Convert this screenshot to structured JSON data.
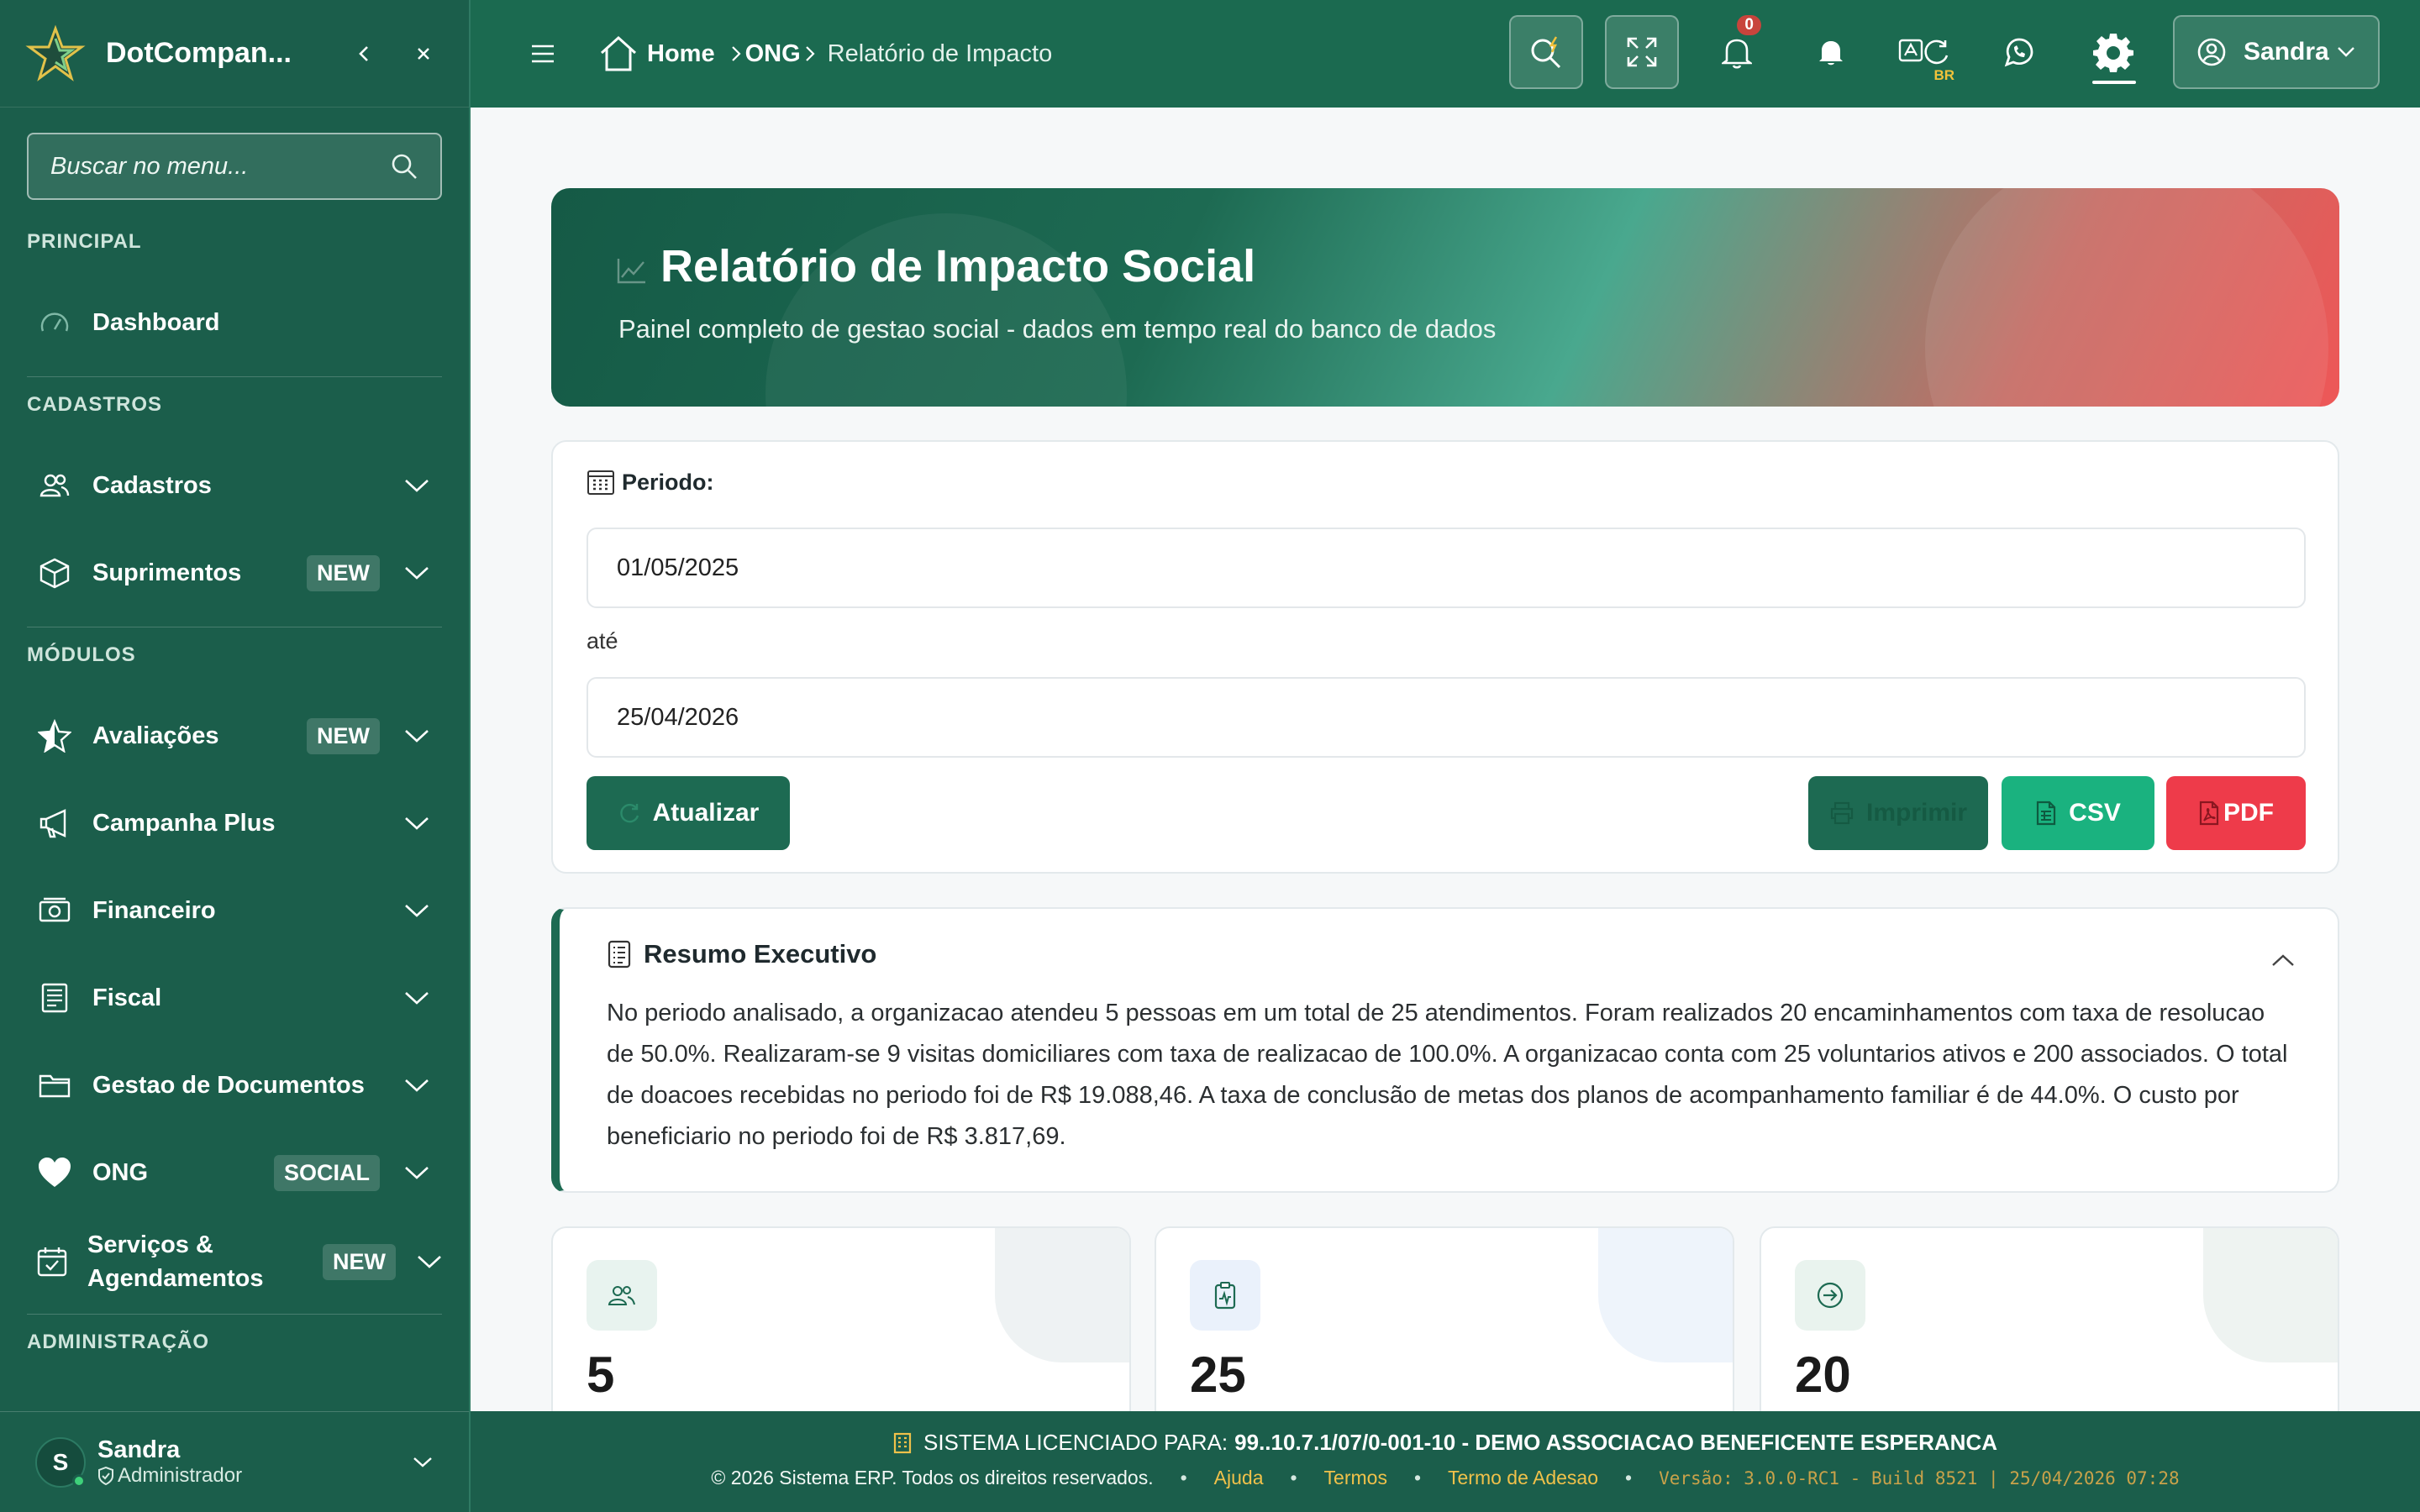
{
  "app": {
    "brand": "DotCompan..."
  },
  "sidebar": {
    "search_placeholder": "Buscar no menu...",
    "sections": {
      "principal": "PRINCIPAL",
      "cadastros": "CADASTROS",
      "modulos": "MÓDULOS",
      "administracao": "ADMINISTRAÇÃO"
    },
    "items": [
      {
        "label": "Dashboard"
      },
      {
        "label": "Cadastros"
      },
      {
        "label": "Suprimentos",
        "badge": "NEW"
      },
      {
        "label": "Avaliações",
        "badge": "NEW"
      },
      {
        "label": "Campanha Plus"
      },
      {
        "label": "Financeiro"
      },
      {
        "label": "Fiscal"
      },
      {
        "label": "Gestao de Documentos"
      },
      {
        "label": "ONG",
        "badge": "SOCIAL"
      },
      {
        "label": "Serviços & Agendamentos",
        "badge": "NEW"
      }
    ],
    "user": {
      "initial": "S",
      "name": "Sandra",
      "role": "Administrador"
    }
  },
  "topbar": {
    "breadcrumb": {
      "home": "Home",
      "section": "ONG",
      "current": "Relatório de Impacto"
    },
    "notifications_count": "0",
    "lang_code": "BR",
    "user_name": "Sandra"
  },
  "hero": {
    "title": "Relatório de Impacto Social",
    "subtitle": "Painel completo de gestao social - dados em tempo real do banco de dados"
  },
  "period": {
    "label": "Periodo:",
    "start": "01/05/2025",
    "between": "até",
    "end": "25/04/2026",
    "refresh_label": "Atualizar",
    "print_label": "Imprimir",
    "csv_label": "CSV",
    "pdf_label": "PDF"
  },
  "summary": {
    "title": "Resumo Executivo",
    "text": "No periodo analisado, a organizacao atendeu 5 pessoas em um total de 25 atendimentos. Foram realizados 20 encaminhamentos com taxa de resolucao de 50.0%. Realizaram-se 9 visitas domiciliares com taxa de realizacao de 100.0%. A organizacao conta com 25 voluntarios ativos e 200 associados. O total de doacoes recebidas no periodo foi de R$ 19.088,46. A taxa de conclusão de metas dos planos de acompanhamento familiar é de 44.0%. O custo por beneficiario no periodo foi de R$ 3.817,69."
  },
  "stats": [
    {
      "value": "5",
      "icon": "people-icon",
      "tint": "#e8f3ef",
      "corner": "#eef2f3"
    },
    {
      "value": "25",
      "icon": "clipboard-pulse-icon",
      "tint": "#eaf1fb",
      "corner": "#eef4fb"
    },
    {
      "value": "20",
      "icon": "arrow-circle-icon",
      "tint": "#e9f3ee",
      "corner": "#eef3f1"
    }
  ],
  "footer": {
    "license_prefix": "SISTEMA LICENCIADO PARA:",
    "license_holder": "99..10.7.1/07/0-001-10 - DEMO ASSOCIACAO BENEFICENTE ESPERANCA",
    "copyright": "© 2026 Sistema ERP. Todos os direitos reservados.",
    "links": [
      "Ajuda",
      "Termos",
      "Termo de Adesao"
    ],
    "version": "Versão: 3.0.0-RC1 - Build 8521 | 25/04/2026 07:28"
  },
  "colors": {
    "primary": "#1b5e4b",
    "accent_green": "#1ab27f",
    "danger": "#ee3b4a",
    "gold": "#f0c14a"
  }
}
